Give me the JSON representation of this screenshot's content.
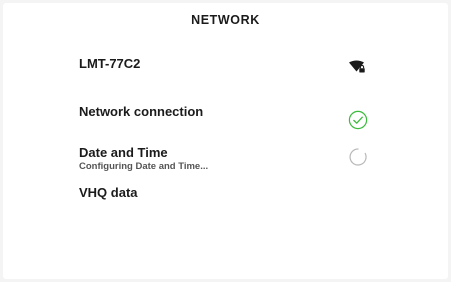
{
  "header": {
    "title": "NETWORK"
  },
  "rows": [
    {
      "label": "LMT-77C2",
      "icon": "wifi-locked-icon"
    },
    {
      "label": "Network connection",
      "icon": "check-circle-icon"
    },
    {
      "label": "Date and Time",
      "sublabel": "Configuring Date and Time...",
      "icon": "loading-spinner-icon"
    },
    {
      "label": "VHQ data"
    }
  ],
  "colors": {
    "background": "#ffffff",
    "text": "#1b1b1b",
    "success": "#3dbb3d",
    "spinner": "#b8b8b8"
  }
}
